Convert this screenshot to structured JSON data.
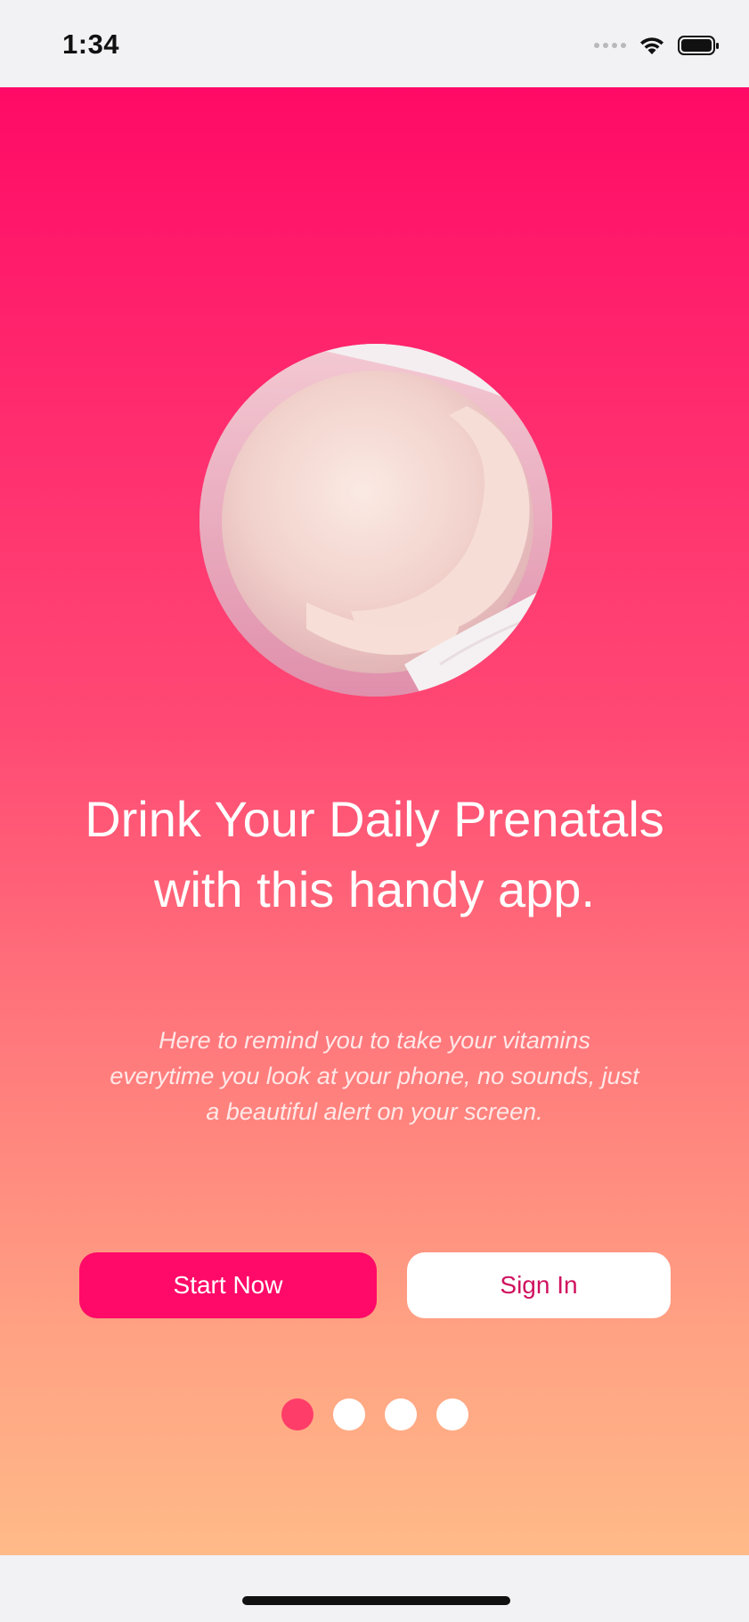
{
  "status_bar": {
    "time": "1:34",
    "icons": [
      "signal-dots-icon",
      "wifi-icon",
      "battery-icon"
    ]
  },
  "onboarding": {
    "hero_image": "pregnant-belly-photo",
    "headline": "Drink Your Daily Prenatals with this handy app.",
    "subtext": "Here to remind you to take your vitamins everytime you look at your phone, no sounds, just a beautiful alert on your screen.",
    "buttons": {
      "start_label": "Start Now",
      "signin_label": "Sign In"
    },
    "pager": {
      "count": 4,
      "active_index": 0
    },
    "colors": {
      "gradient_top": "#ff0a66",
      "gradient_bottom": "#ffba88",
      "start_button": "#ff0a68",
      "signin_text": "#d0115f",
      "active_dot": "#ff3d69"
    }
  }
}
